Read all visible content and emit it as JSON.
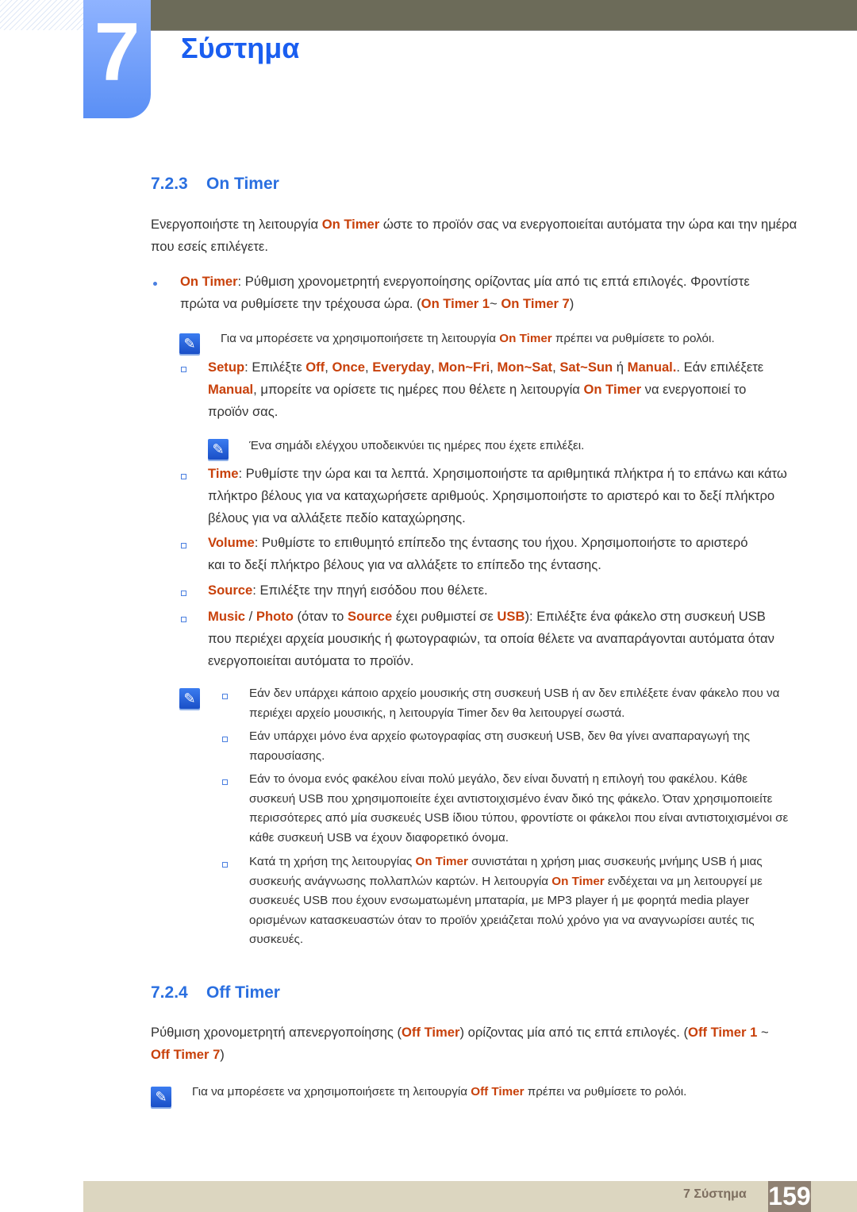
{
  "chapter": {
    "number": "7",
    "title": "Σύστημα"
  },
  "colors": {
    "highlight": "#c8410b",
    "heading": "#2a6fe0",
    "chapter_title": "#1a5ef0",
    "footer_bg": "#dcd6c0",
    "page_box": "#8f8173"
  },
  "section_723": {
    "number": "7.2.3",
    "title": "On Timer"
  },
  "section_724": {
    "number": "7.2.4",
    "title": "Off Timer"
  },
  "blocks": [
    {
      "id": "intro",
      "segs": [
        {
          "t": "Ενεργοποιήστε τη λειτουργία "
        },
        {
          "t": "On Timer",
          "h": true
        },
        {
          "t": " ώστε το προϊόν σας να ενεργοποιείται αυτόματα την ώρα και την ημέρα που εσείς επιλέγετε."
        }
      ]
    },
    {
      "id": "bullet-on-timer",
      "segs": [
        {
          "t": "On Timer",
          "h": true
        },
        {
          "t": ": Ρύθμιση χρονομετρητή ενεργοποίησης ορίζοντας μία από τις επτά επιλογές. Φροντίστε πρώτα να ρυθμίσετε την τρέχουσα ώρα. ("
        },
        {
          "t": "On Timer 1",
          "h": true
        },
        {
          "t": "~ "
        },
        {
          "t": "On Timer 7",
          "h": true
        },
        {
          "t": ")"
        }
      ]
    },
    {
      "id": "note-clock",
      "segs": [
        {
          "t": "Για να μπορέσετε να χρησιμοποιήσετε τη λειτουργία "
        },
        {
          "t": "On Timer",
          "h": true
        },
        {
          "t": " πρέπει να ρυθμίσετε το ρολόι."
        }
      ]
    },
    {
      "id": "setup",
      "segs": [
        {
          "t": "Setup",
          "h": true
        },
        {
          "t": ": Επιλέξτε "
        },
        {
          "t": "Off",
          "h": true
        },
        {
          "t": ", "
        },
        {
          "t": "Once",
          "h": true
        },
        {
          "t": ", "
        },
        {
          "t": "Everyday",
          "h": true
        },
        {
          "t": ", "
        },
        {
          "t": "Mon~Fri",
          "h": true
        },
        {
          "t": ", "
        },
        {
          "t": "Mon~Sat",
          "h": true
        },
        {
          "t": ", "
        },
        {
          "t": "Sat~Sun",
          "h": true
        },
        {
          "t": " ή "
        },
        {
          "t": "Manual.",
          "h": true
        },
        {
          "t": ". Εάν επιλέξετε "
        },
        {
          "t": "Manual",
          "h": true
        },
        {
          "t": ", μπορείτε να ορίσετε τις ημέρες που θέλετε η λειτουργία "
        },
        {
          "t": "On Timer",
          "h": true
        },
        {
          "t": " να ενεργοποιεί το προϊόν σας."
        }
      ]
    },
    {
      "id": "note-check",
      "segs": [
        {
          "t": "Ένα σημάδι ελέγχου υποδεικνύει τις ημέρες που έχετε επιλέξει."
        }
      ]
    },
    {
      "id": "time",
      "segs": [
        {
          "t": "Time",
          "h": true
        },
        {
          "t": ": Ρυθμίστε την ώρα και τα λεπτά. Χρησιμοποιήστε τα αριθμητικά πλήκτρα ή το επάνω και κάτω πλήκτρο βέλους για να καταχωρήσετε αριθμούς. Χρησιμοποιήστε το αριστερό και το δεξί πλήκτρο βέλους για να αλλάξετε πεδίο καταχώρησης."
        }
      ]
    },
    {
      "id": "volume",
      "segs": [
        {
          "t": "Volume",
          "h": true
        },
        {
          "t": ": Ρυθμίστε το επιθυμητό επίπεδο της έντασης του ήχου. Χρησιμοποιήστε το αριστερό και το δεξί πλήκτρο βέλους για να αλλάξετε το επίπεδο της έντασης."
        }
      ]
    },
    {
      "id": "source",
      "segs": [
        {
          "t": "Source",
          "h": true
        },
        {
          "t": ": Επιλέξτε την πηγή εισόδου που θέλετε."
        }
      ]
    },
    {
      "id": "music",
      "segs": [
        {
          "t": "Music",
          "h": true
        },
        {
          "t": " / "
        },
        {
          "t": "Photo",
          "h": true
        },
        {
          "t": " (όταν το "
        },
        {
          "t": "Source",
          "h": true
        },
        {
          "t": " έχει ρυθμιστεί σε "
        },
        {
          "t": "USB",
          "h": true
        },
        {
          "t": "): Επιλέξτε ένα φάκελο στη συσκευή USB που περιέχει αρχεία μουσικής ή φωτογραφιών, τα οποία θέλετε να αναπαράγονται αυτόματα όταν ενεργοποιείται αυτόματα το προϊόν."
        }
      ]
    },
    {
      "id": "n1",
      "segs": [
        {
          "t": "Εάν δεν υπάρχει κάποιο αρχείο μουσικής στη συσκευή USB ή αν δεν επιλέξετε έναν φάκελο που να περιέχει αρχείο μουσικής, η λειτουργία Timer δεν θα λειτουργεί σωστά."
        }
      ]
    },
    {
      "id": "n2",
      "segs": [
        {
          "t": "Εάν υπάρχει μόνο ένα αρχείο φωτογραφίας στη συσκευή USB, δεν θα γίνει αναπαραγωγή της παρουσίασης."
        }
      ]
    },
    {
      "id": "n3",
      "segs": [
        {
          "t": "Εάν το όνομα ενός φακέλου είναι πολύ μεγάλο, δεν είναι δυνατή η επιλογή του φακέλου. Κάθε συσκευή USB που χρησιμοποιείτε έχει αντιστοιχισμένο έναν δικό της φάκελο. Όταν χρησιμοποιείτε περισσότερες από μία συσκευές USB ίδιου τύπου, φροντίστε οι φάκελοι που είναι αντιστοιχισμένοι σε κάθε συσκευή USB να έχουν διαφορετικό όνομα."
        }
      ]
    },
    {
      "id": "n4",
      "segs": [
        {
          "t": "Κατά τη χρήση της λειτουργίας "
        },
        {
          "t": "On Timer",
          "h": true
        },
        {
          "t": " συνιστάται η χρήση μιας συσκευής μνήμης USB ή μιας συσκευής ανάγνωσης πολλαπλών καρτών. Η λειτουργία "
        },
        {
          "t": "On Timer",
          "h": true
        },
        {
          "t": " ενδέχεται να μη λειτουργεί με συσκευές USB που έχουν ενσωματωμένη μπαταρία, με MP3 player ή με φορητά media player ορισμένων κατασκευαστών όταν το προϊόν χρειάζεται πολύ χρόνο για να αναγνωρίσει αυτές τις συσκευές."
        }
      ]
    },
    {
      "id": "off-intro",
      "segs": [
        {
          "t": "Ρύθμιση χρονομετρητή απενεργοποίησης ("
        },
        {
          "t": "Off Timer",
          "h": true
        },
        {
          "t": ") ορίζοντας μία από τις επτά επιλογές. ("
        },
        {
          "t": "Off Timer 1",
          "h": true
        },
        {
          "t": " ~ "
        },
        {
          "t": "Off Timer 7",
          "h": true
        },
        {
          "t": ")"
        }
      ]
    },
    {
      "id": "off-note",
      "segs": [
        {
          "t": "Για να μπορέσετε να χρησιμοποιήσετε τη λειτουργία "
        },
        {
          "t": "Off Timer",
          "h": true
        },
        {
          "t": " πρέπει να ρυθμίσετε το ρολόι."
        }
      ]
    }
  ],
  "footer": {
    "chapter_label": "7 Σύστημα",
    "page_number": "159"
  },
  "icons": {
    "note": "note-pencil-icon",
    "bullet": "round-bullet",
    "sub_bullet": "square-bullet"
  }
}
